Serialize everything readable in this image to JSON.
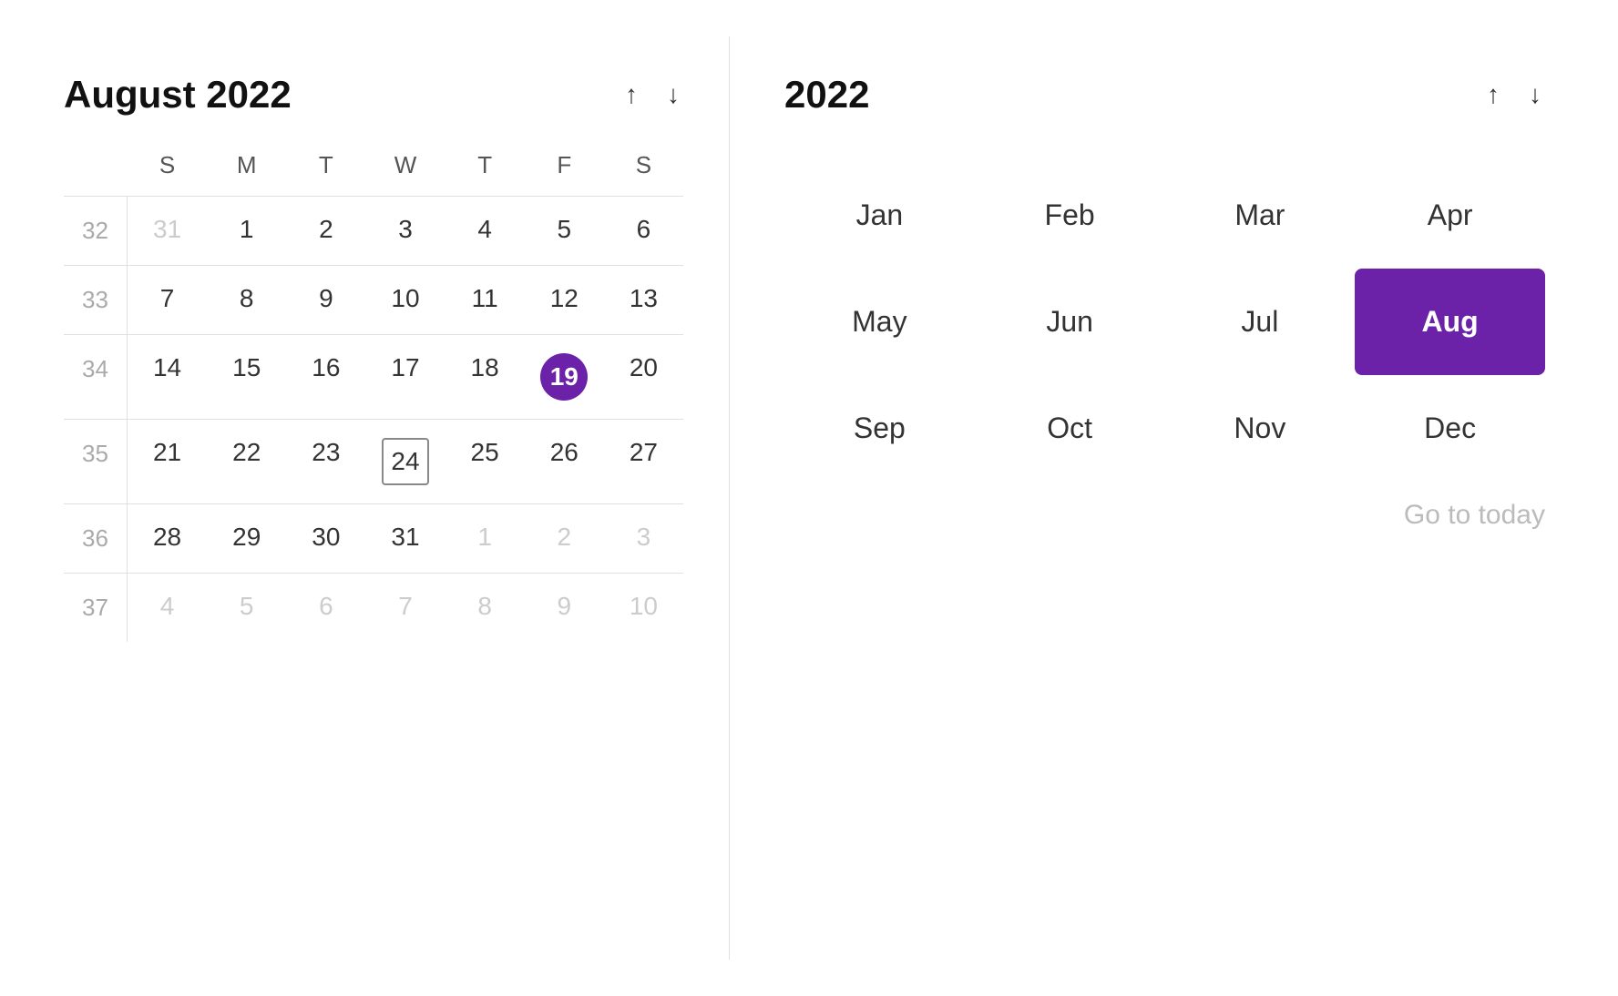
{
  "left": {
    "title": "August 2022",
    "day_headers": [
      "S",
      "M",
      "T",
      "W",
      "T",
      "F",
      "S"
    ],
    "weeks": [
      {
        "week_num": "32",
        "days": [
          {
            "num": "31",
            "dimmed": true
          },
          {
            "num": "1",
            "dimmed": false
          },
          {
            "num": "2",
            "dimmed": false
          },
          {
            "num": "3",
            "dimmed": false
          },
          {
            "num": "4",
            "dimmed": false
          },
          {
            "num": "5",
            "dimmed": false
          },
          {
            "num": "6",
            "dimmed": false
          }
        ]
      },
      {
        "week_num": "33",
        "days": [
          {
            "num": "7",
            "dimmed": false
          },
          {
            "num": "8",
            "dimmed": false
          },
          {
            "num": "9",
            "dimmed": false
          },
          {
            "num": "10",
            "dimmed": false
          },
          {
            "num": "11",
            "dimmed": false
          },
          {
            "num": "12",
            "dimmed": false
          },
          {
            "num": "13",
            "dimmed": false
          }
        ]
      },
      {
        "week_num": "34",
        "days": [
          {
            "num": "14",
            "dimmed": false
          },
          {
            "num": "15",
            "dimmed": false
          },
          {
            "num": "16",
            "dimmed": false
          },
          {
            "num": "17",
            "dimmed": false
          },
          {
            "num": "18",
            "dimmed": false
          },
          {
            "num": "19",
            "dimmed": false,
            "selected": true
          },
          {
            "num": "20",
            "dimmed": false
          }
        ]
      },
      {
        "week_num": "35",
        "days": [
          {
            "num": "21",
            "dimmed": false
          },
          {
            "num": "22",
            "dimmed": false
          },
          {
            "num": "23",
            "dimmed": false
          },
          {
            "num": "24",
            "dimmed": false,
            "outlined": true
          },
          {
            "num": "25",
            "dimmed": false
          },
          {
            "num": "26",
            "dimmed": false
          },
          {
            "num": "27",
            "dimmed": false
          }
        ]
      },
      {
        "week_num": "36",
        "days": [
          {
            "num": "28",
            "dimmed": false
          },
          {
            "num": "29",
            "dimmed": false
          },
          {
            "num": "30",
            "dimmed": false
          },
          {
            "num": "31",
            "dimmed": false
          },
          {
            "num": "1",
            "dimmed": true
          },
          {
            "num": "2",
            "dimmed": true
          },
          {
            "num": "3",
            "dimmed": true
          }
        ]
      },
      {
        "week_num": "37",
        "days": [
          {
            "num": "4",
            "dimmed": true
          },
          {
            "num": "5",
            "dimmed": true
          },
          {
            "num": "6",
            "dimmed": true
          },
          {
            "num": "7",
            "dimmed": true
          },
          {
            "num": "8",
            "dimmed": true
          },
          {
            "num": "9",
            "dimmed": true
          },
          {
            "num": "10",
            "dimmed": true
          }
        ]
      }
    ]
  },
  "right": {
    "year": "2022",
    "months": [
      {
        "label": "Jan",
        "active": false
      },
      {
        "label": "Feb",
        "active": false
      },
      {
        "label": "Mar",
        "active": false
      },
      {
        "label": "Apr",
        "active": false
      },
      {
        "label": "May",
        "active": false
      },
      {
        "label": "Jun",
        "active": false
      },
      {
        "label": "Jul",
        "active": false
      },
      {
        "label": "Aug",
        "active": true
      },
      {
        "label": "Sep",
        "active": false
      },
      {
        "label": "Oct",
        "active": false
      },
      {
        "label": "Nov",
        "active": false
      },
      {
        "label": "Dec",
        "active": false
      }
    ],
    "goto_today": "Go to today"
  },
  "nav": {
    "up_arrow": "↑",
    "down_arrow": "↓"
  }
}
